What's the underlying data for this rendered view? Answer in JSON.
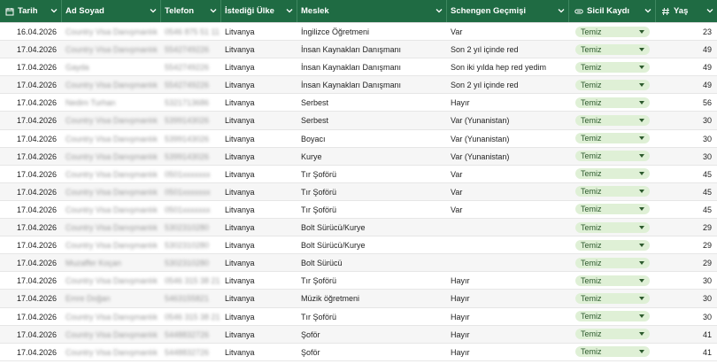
{
  "columns": [
    {
      "label": "Tarih",
      "icon": "calendar-icon"
    },
    {
      "label": "Ad Soyad"
    },
    {
      "label": "Telefon"
    },
    {
      "label": "İstediği Ülke"
    },
    {
      "label": "Meslek"
    },
    {
      "label": "Schengen Geçmişi"
    },
    {
      "label": "Sicil Kaydı",
      "icon": "link-icon"
    },
    {
      "label": "Yaş",
      "icon": "hash-icon"
    }
  ],
  "colors": {
    "header_bg": "#1f6b43",
    "pill_bg": "#dff0d6"
  },
  "rows": [
    {
      "tarih": "16.04.2026",
      "ad": "Country Visa Danışmanlık",
      "tel": "0546 875 51 11",
      "ulke": "Litvanya",
      "meslek": "İngilizce Öğretmeni",
      "schengen": "Var",
      "sicil": "Temiz",
      "yas": "23"
    },
    {
      "tarih": "17.04.2026",
      "ad": "Country Visa Danışmanlık",
      "tel": "5542749226",
      "ulke": "Litvanya",
      "meslek": "İnsan Kaynakları Danışmanı",
      "schengen": "Son 2 yıl içinde red",
      "sicil": "Temiz",
      "yas": "49"
    },
    {
      "tarih": "17.04.2026",
      "ad": "Gayda",
      "tel": "5542749226",
      "ulke": "Litvanya",
      "meslek": "İnsan Kaynakları Danışmanı",
      "schengen": "Son iki yılda hep red yedim",
      "sicil": "Temiz",
      "yas": "49"
    },
    {
      "tarih": "17.04.2026",
      "ad": "Country Visa Danışmanlık",
      "tel": "5542749226",
      "ulke": "Litvanya",
      "meslek": "İnsan Kaynakları Danışmanı",
      "schengen": "Son 2 yıl içinde red",
      "sicil": "Temiz",
      "yas": "49"
    },
    {
      "tarih": "17.04.2026",
      "ad": "Nedim Turhan",
      "tel": "5321713686",
      "ulke": "Litvanya",
      "meslek": "Serbest",
      "schengen": "Hayır",
      "sicil": "Temiz",
      "yas": "56"
    },
    {
      "tarih": "17.04.2026",
      "ad": "Country Visa Danışmanlık",
      "tel": "5399143026",
      "ulke": "Litvanya",
      "meslek": "Serbest",
      "schengen": "Var (Yunanistan)",
      "sicil": "Temiz",
      "yas": "30"
    },
    {
      "tarih": "17.04.2026",
      "ad": "Country Visa Danışmanlık",
      "tel": "5399143026",
      "ulke": "Litvanya",
      "meslek": "Boyacı",
      "schengen": "Var (Yunanistan)",
      "sicil": "Temiz",
      "yas": "30"
    },
    {
      "tarih": "17.04.2026",
      "ad": "Country Visa Danışmanlık",
      "tel": "5399143026",
      "ulke": "Litvanya",
      "meslek": "Kurye",
      "schengen": "Var (Yunanistan)",
      "sicil": "Temiz",
      "yas": "30"
    },
    {
      "tarih": "17.04.2026",
      "ad": "Country Visa Danışmanlık",
      "tel": "0501xxxxxxx",
      "ulke": "Litvanya",
      "meslek": "Tır Şoförü",
      "schengen": "Var",
      "sicil": "Temiz",
      "yas": "45"
    },
    {
      "tarih": "17.04.2026",
      "ad": "Country Visa Danışmanlık",
      "tel": "0501xxxxxxx",
      "ulke": "Litvanya",
      "meslek": "Tır Şoförü",
      "schengen": "Var",
      "sicil": "Temiz",
      "yas": "45"
    },
    {
      "tarih": "17.04.2026",
      "ad": "Country Visa Danışmanlık",
      "tel": "0501xxxxxxx",
      "ulke": "Litvanya",
      "meslek": "Tır Şoförü",
      "schengen": "Var",
      "sicil": "Temiz",
      "yas": "45"
    },
    {
      "tarih": "17.04.2026",
      "ad": "Country Visa Danışmanlık",
      "tel": "5302310280",
      "ulke": "Litvanya",
      "meslek": "Bolt Sürücü/Kurye",
      "schengen": "",
      "sicil": "Temiz",
      "yas": "29"
    },
    {
      "tarih": "17.04.2026",
      "ad": "Country Visa Danışmanlık",
      "tel": "5302310280",
      "ulke": "Litvanya",
      "meslek": "Bolt Sürücü/Kurye",
      "schengen": "",
      "sicil": "Temiz",
      "yas": "29"
    },
    {
      "tarih": "17.04.2026",
      "ad": "Muzaffer Koçan",
      "tel": "5302310280",
      "ulke": "Litvanya",
      "meslek": "Bolt Sürücü",
      "schengen": "",
      "sicil": "Temiz",
      "yas": "29"
    },
    {
      "tarih": "17.04.2026",
      "ad": "Country Visa Danışmanlık",
      "tel": "0546 315 38 21",
      "ulke": "Litvanya",
      "meslek": "Tır Şoförü",
      "schengen": "Hayır",
      "sicil": "Temiz",
      "yas": "30"
    },
    {
      "tarih": "17.04.2026",
      "ad": "Emre Doğan",
      "tel": "5463155821",
      "ulke": "Litvanya",
      "meslek": "Müzik öğretmeni",
      "schengen": "Hayır",
      "sicil": "Temiz",
      "yas": "30"
    },
    {
      "tarih": "17.04.2026",
      "ad": "Country Visa Danışmanlık",
      "tel": "0546 315 38 21",
      "ulke": "Litvanya",
      "meslek": "Tır Şoförü",
      "schengen": "Hayır",
      "sicil": "Temiz",
      "yas": "30"
    },
    {
      "tarih": "17.04.2026",
      "ad": "Country Visa Danışmanlık",
      "tel": "5448832726",
      "ulke": "Litvanya",
      "meslek": "Şoför",
      "schengen": "Hayır",
      "sicil": "Temiz",
      "yas": "41"
    },
    {
      "tarih": "17.04.2026",
      "ad": "Country Visa Danışmanlık",
      "tel": "5448832726",
      "ulke": "Litvanya",
      "meslek": "Şoför",
      "schengen": "Hayır",
      "sicil": "Temiz",
      "yas": "41"
    }
  ]
}
